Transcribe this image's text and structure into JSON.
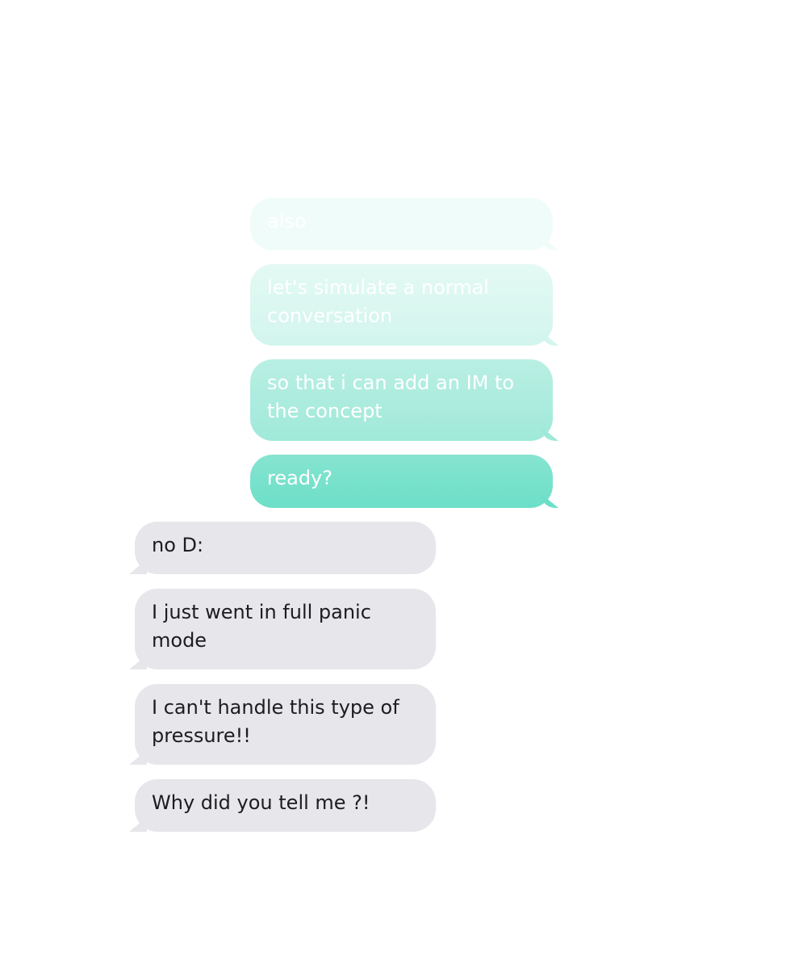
{
  "conversation": {
    "outgoing": [
      {
        "text": "also"
      },
      {
        "text": "let's simulate a normal conversation"
      },
      {
        "text": "so that i can add an IM to the concept"
      },
      {
        "text": "ready?"
      }
    ],
    "incoming": [
      {
        "text": "no D:"
      },
      {
        "text": "I just went in full panic mode"
      },
      {
        "text": "I can't handle this type of pressure!!"
      },
      {
        "text": "Why did you tell me ?!"
      }
    ]
  },
  "colors": {
    "outgoing_accent": "#6cdfc8",
    "incoming_bubble": "#e6e6eb",
    "incoming_text": "#1d1d1f",
    "outgoing_text": "#ffffff"
  }
}
